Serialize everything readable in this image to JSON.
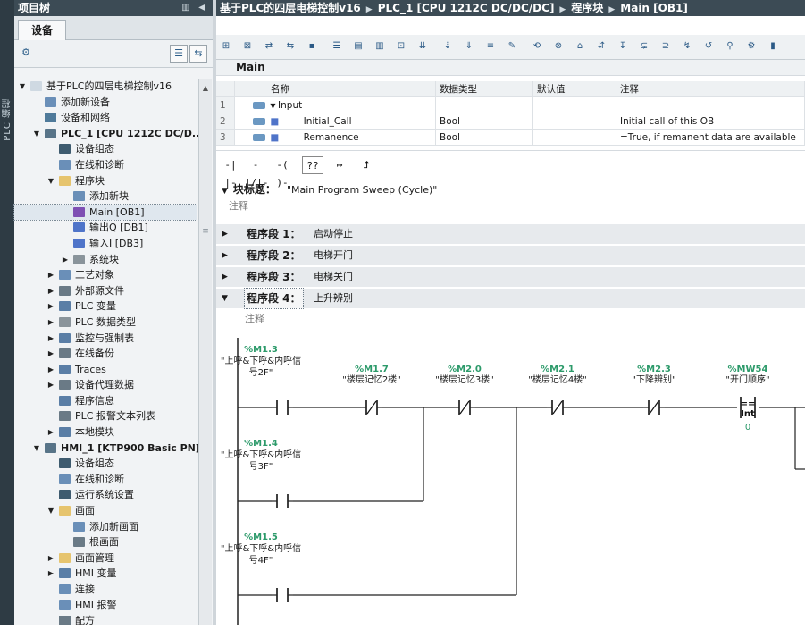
{
  "rail": {
    "label": "PLC 编程"
  },
  "tree_panel": {
    "title": "项目树",
    "tab": "设备",
    "items": [
      {
        "label": "基于PLC的四层电梯控制v16",
        "level": 0,
        "expand": "▼",
        "color": "#cfd9e2"
      },
      {
        "label": "添加新设备",
        "level": 1,
        "expand": "",
        "color": "#6a8fb8"
      },
      {
        "label": "设备和网络",
        "level": 1,
        "expand": "",
        "color": "#4f7a9a"
      },
      {
        "label": "PLC_1 [CPU 1212C DC/D...",
        "level": 1,
        "expand": "▼",
        "color": "#587488",
        "bold": true
      },
      {
        "label": "设备组态",
        "level": 2,
        "expand": "",
        "color": "#3e5b6f"
      },
      {
        "label": "在线和诊断",
        "level": 2,
        "expand": "",
        "color": "#6a8fb8"
      },
      {
        "label": "程序块",
        "level": 2,
        "expand": "▼",
        "color": "#e6c46e"
      },
      {
        "label": "添加新块",
        "level": 3,
        "expand": "",
        "color": "#6a8fb8"
      },
      {
        "label": "Main [OB1]",
        "level": 3,
        "expand": "",
        "color": "#7e4fb3",
        "selected": true
      },
      {
        "label": "输出Q [DB1]",
        "level": 3,
        "expand": "",
        "color": "#4f74c9"
      },
      {
        "label": "输入I [DB3]",
        "level": 3,
        "expand": "",
        "color": "#4f74c9"
      },
      {
        "label": "系统块",
        "level": 3,
        "expand": "▶",
        "color": "#8a949b"
      },
      {
        "label": "工艺对象",
        "level": 2,
        "expand": "▶",
        "color": "#6a8fb8"
      },
      {
        "label": "外部源文件",
        "level": 2,
        "expand": "▶",
        "color": "#6a7a86"
      },
      {
        "label": "PLC 变量",
        "level": 2,
        "expand": "▶",
        "color": "#5a7ea6"
      },
      {
        "label": "PLC 数据类型",
        "level": 2,
        "expand": "▶",
        "color": "#8a949b"
      },
      {
        "label": "监控与强制表",
        "level": 2,
        "expand": "▶",
        "color": "#5a7ea6"
      },
      {
        "label": "在线备份",
        "level": 2,
        "expand": "▶",
        "color": "#6a7a86"
      },
      {
        "label": "Traces",
        "level": 2,
        "expand": "▶",
        "color": "#5a7ea6"
      },
      {
        "label": "设备代理数据",
        "level": 2,
        "expand": "▶",
        "color": "#6a7a86"
      },
      {
        "label": "程序信息",
        "level": 2,
        "expand": "",
        "color": "#5a7ea6"
      },
      {
        "label": "PLC 报警文本列表",
        "level": 2,
        "expand": "",
        "color": "#6a7a86"
      },
      {
        "label": "本地模块",
        "level": 2,
        "expand": "▶",
        "color": "#5a7ea6"
      },
      {
        "label": "HMI_1 [KTP900 Basic PN]",
        "level": 1,
        "expand": "▼",
        "color": "#587488",
        "bold": true
      },
      {
        "label": "设备组态",
        "level": 2,
        "expand": "",
        "color": "#3e5b6f"
      },
      {
        "label": "在线和诊断",
        "level": 2,
        "expand": "",
        "color": "#6a8fb8"
      },
      {
        "label": "运行系统设置",
        "level": 2,
        "expand": "",
        "color": "#3e5b6f"
      },
      {
        "label": "画面",
        "level": 2,
        "expand": "▼",
        "color": "#e6c46e"
      },
      {
        "label": "添加新画面",
        "level": 3,
        "expand": "",
        "color": "#6a8fb8"
      },
      {
        "label": "根画面",
        "level": 3,
        "expand": "",
        "color": "#6a7a86"
      },
      {
        "label": "画面管理",
        "level": 2,
        "expand": "▶",
        "color": "#e6c46e"
      },
      {
        "label": "HMI 变量",
        "level": 2,
        "expand": "▶",
        "color": "#5a7ea6"
      },
      {
        "label": "连接",
        "level": 2,
        "expand": "",
        "color": "#6a8fb8"
      },
      {
        "label": "HMI 报警",
        "level": 2,
        "expand": "",
        "color": "#6a8fb8"
      },
      {
        "label": "配方",
        "level": 2,
        "expand": "",
        "color": "#6a7a86"
      }
    ]
  },
  "breadcrumb": {
    "parts": [
      "基于PLC的四层电梯控制v16",
      "PLC_1 [CPU 1212C DC/DC/DC]",
      "程序块",
      "Main [OB1]"
    ]
  },
  "block": {
    "name": "Main",
    "columns": [
      "名称",
      "数据类型",
      "默认值",
      "注释"
    ],
    "rows": [
      {
        "num": "1",
        "name": "Input",
        "type": "",
        "default": "",
        "comment": ""
      },
      {
        "num": "2",
        "name": "Initial_Call",
        "type": "Bool",
        "default": "",
        "comment": "Initial call of this OB"
      },
      {
        "num": "3",
        "name": "Remanence",
        "type": "Bool",
        "default": "",
        "comment": "=True, if remanent data are available"
      }
    ],
    "instructions": [
      "-| |-",
      "-|/|-",
      "-( )-",
      "??",
      "↦",
      "⮥"
    ],
    "title_label": "块标题：",
    "title_value": "\"Main Program Sweep (Cycle)\"",
    "comment_label": "注释",
    "networks": [
      {
        "label": "程序段 1：",
        "title": "启动停止",
        "expand": "▶"
      },
      {
        "label": "程序段 2：",
        "title": "电梯开门",
        "expand": "▶"
      },
      {
        "label": "程序段 3：",
        "title": "电梯关门",
        "expand": "▶"
      },
      {
        "label": "程序段 4：",
        "title": "上升辨别",
        "expand": "▼",
        "selected": true
      }
    ],
    "network_comment": "注释"
  },
  "ladder": {
    "contacts": [
      {
        "addr": "%M1.3",
        "name": "\"上呼&下呼&内呼信号2F\"",
        "type": "no"
      },
      {
        "addr": "%M1.7",
        "name": "\"楼层记忆2楼\"",
        "type": "nc"
      },
      {
        "addr": "%M2.0",
        "name": "\"楼层记忆3楼\"",
        "type": "nc"
      },
      {
        "addr": "%M2.1",
        "name": "\"楼层记忆4楼\"",
        "type": "nc"
      },
      {
        "addr": "%M2.3",
        "name": "\"下降辨别\"",
        "type": "nc"
      },
      {
        "addr": "%MW54",
        "name": "\"开门顺序\"",
        "type": "cmp",
        "op": "==",
        "dtype": "Int",
        "value": "0"
      },
      {
        "addr": "%M1.4",
        "name": "\"上呼&下呼&内呼信号3F\"",
        "type": "no"
      },
      {
        "addr": "%M1.5",
        "name": "\"上呼&下呼&内呼信号4F\"",
        "type": "no"
      }
    ]
  },
  "colors": {
    "header": "#3c4b55",
    "tag_green": "#2c9a6a",
    "selection": "#dfe7ee"
  }
}
